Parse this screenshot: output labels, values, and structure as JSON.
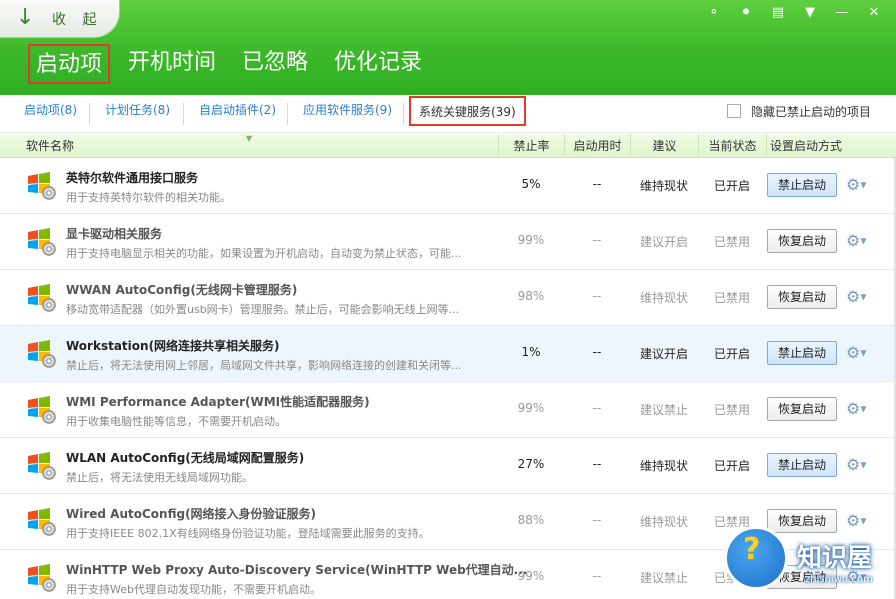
{
  "header": {
    "collapse_label": "收 起",
    "window_icons": [
      "share-icon",
      "skin-icon",
      "feedback-icon",
      "menu-icon",
      "minimize-icon",
      "close-icon"
    ],
    "main_tabs": [
      {
        "label": "启动项",
        "active": true
      },
      {
        "label": "开机时间",
        "active": false
      },
      {
        "label": "已忽略",
        "active": false
      },
      {
        "label": "优化记录",
        "active": false
      }
    ]
  },
  "subtabs": [
    {
      "label": "启动项(8)"
    },
    {
      "label": "计划任务(8)"
    },
    {
      "label": "自启动插件(2)"
    },
    {
      "label": "应用软件服务(9)"
    },
    {
      "label": "系统关键服务(39)",
      "active": true
    }
  ],
  "hide_disabled_label": "隐藏已禁止启动的项目",
  "columns": {
    "name": "软件名称",
    "rate": "禁止率",
    "time": "启动用时",
    "advice": "建议",
    "state": "当前状态",
    "action": "设置启动方式"
  },
  "rows": [
    {
      "name": "英特尔软件通用接口服务",
      "desc": "用于支持英特尔软件的相关功能。",
      "rate": "5%",
      "time": "--",
      "advice": "维持现状",
      "state": "已开启",
      "action": "禁止启动"
    },
    {
      "name": "显卡驱动相关服务",
      "desc": "用于支持电脑显示相关的功能，如果设置为开机启动，自动变为禁止状态，可能...",
      "rate": "99%",
      "time": "--",
      "advice": "建议开启",
      "state": "已禁用",
      "action": "恢复启动"
    },
    {
      "name": "WWAN AutoConfig(无线网卡管理服务)",
      "desc": "移动宽带适配器（如外置usb网卡）管理服务。禁止后，可能会影响无线上网等...",
      "rate": "98%",
      "time": "--",
      "advice": "维持现状",
      "state": "已禁用",
      "action": "恢复启动"
    },
    {
      "name": "Workstation(网络连接共享相关服务)",
      "desc": "禁止后，将无法使用网上邻居，局域网文件共享，影响网络连接的创建和关闭等...",
      "rate": "1%",
      "time": "--",
      "advice": "建议开启",
      "state": "已开启",
      "action": "禁止启动"
    },
    {
      "name": "WMI Performance Adapter(WMI性能适配器服务)",
      "desc": "用于收集电脑性能等信息，不需要开机启动。",
      "rate": "99%",
      "time": "--",
      "advice": "建议禁止",
      "state": "已禁用",
      "action": "恢复启动"
    },
    {
      "name": "WLAN AutoConfig(无线局域网配置服务)",
      "desc": "禁止后，将无法使用无线局域网功能。",
      "rate": "27%",
      "time": "--",
      "advice": "维持现状",
      "state": "已开启",
      "action": "禁止启动"
    },
    {
      "name": "Wired AutoConfig(网络接入身份验证服务)",
      "desc": "用于支持IEEE 802.1X有线网络身份验证功能，登陆域需要此服务的支持。",
      "rate": "88%",
      "time": "--",
      "advice": "维持现状",
      "state": "已禁用",
      "action": "恢复启动"
    },
    {
      "name": "WinHTTP Web Proxy Auto-Discovery Service(WinHTTP Web代理自动...",
      "desc": "用于支持Web代理自动发现功能，不需要开机启动。",
      "rate": "99%",
      "time": "--",
      "advice": "建议禁止",
      "state": "已禁用",
      "action": "恢复启动"
    }
  ],
  "watermark": {
    "title": "知识屋",
    "sub": "zhishiwu.com"
  }
}
